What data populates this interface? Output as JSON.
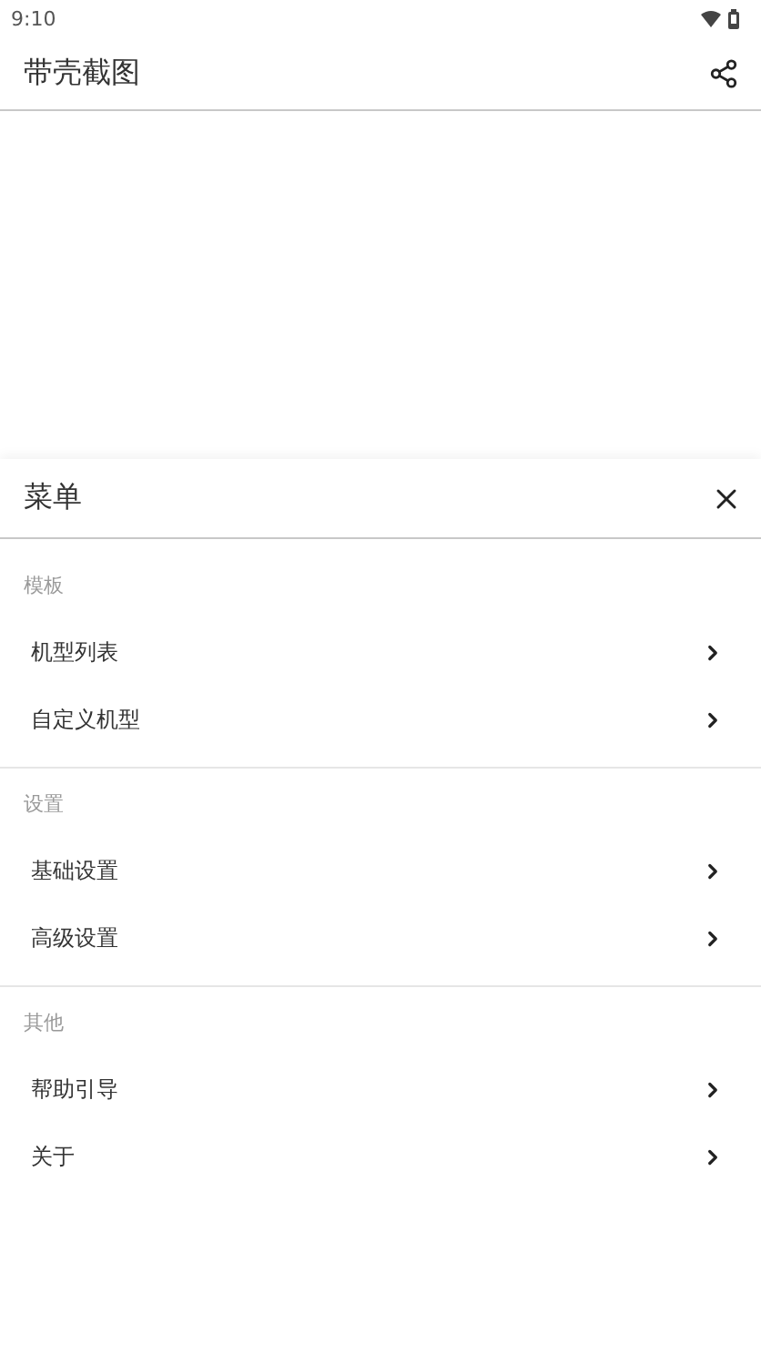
{
  "status_bar": {
    "time": "9:10"
  },
  "app_bar": {
    "title": "带壳截图"
  },
  "menu": {
    "title": "菜单",
    "sections": [
      {
        "header": "模板",
        "items": [
          {
            "label": "机型列表"
          },
          {
            "label": "自定义机型"
          }
        ]
      },
      {
        "header": "设置",
        "items": [
          {
            "label": "基础设置"
          },
          {
            "label": "高级设置"
          }
        ]
      },
      {
        "header": "其他",
        "items": [
          {
            "label": "帮助引导"
          },
          {
            "label": "关于"
          }
        ]
      }
    ]
  }
}
